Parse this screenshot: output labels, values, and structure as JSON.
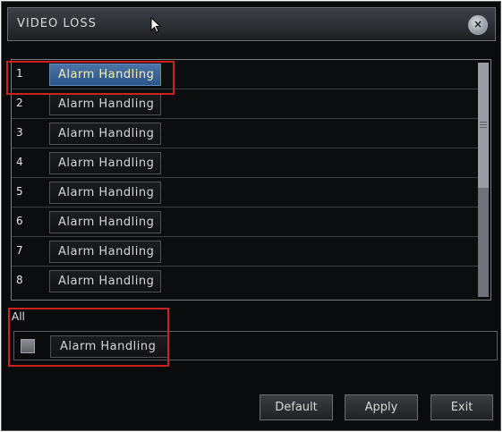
{
  "window": {
    "title": "VIDEO LOSS",
    "close_icon": "close-icon"
  },
  "channels": [
    {
      "number": "1",
      "button_label": "Alarm Handling",
      "selected": true
    },
    {
      "number": "2",
      "button_label": "Alarm Handling",
      "selected": false
    },
    {
      "number": "3",
      "button_label": "Alarm Handling",
      "selected": false
    },
    {
      "number": "4",
      "button_label": "Alarm Handling",
      "selected": false
    },
    {
      "number": "5",
      "button_label": "Alarm Handling",
      "selected": false
    },
    {
      "number": "6",
      "button_label": "Alarm Handling",
      "selected": false
    },
    {
      "number": "7",
      "button_label": "Alarm Handling",
      "selected": false
    },
    {
      "number": "8",
      "button_label": "Alarm Handling",
      "selected": false
    }
  ],
  "all": {
    "label": "All",
    "button_label": "Alarm Handling"
  },
  "footer": {
    "default_label": "Default",
    "apply_label": "Apply",
    "exit_label": "Exit"
  },
  "colors": {
    "highlight": "#d01f1f",
    "selected_button": "#3b6396",
    "background": "#0a0b0c"
  }
}
